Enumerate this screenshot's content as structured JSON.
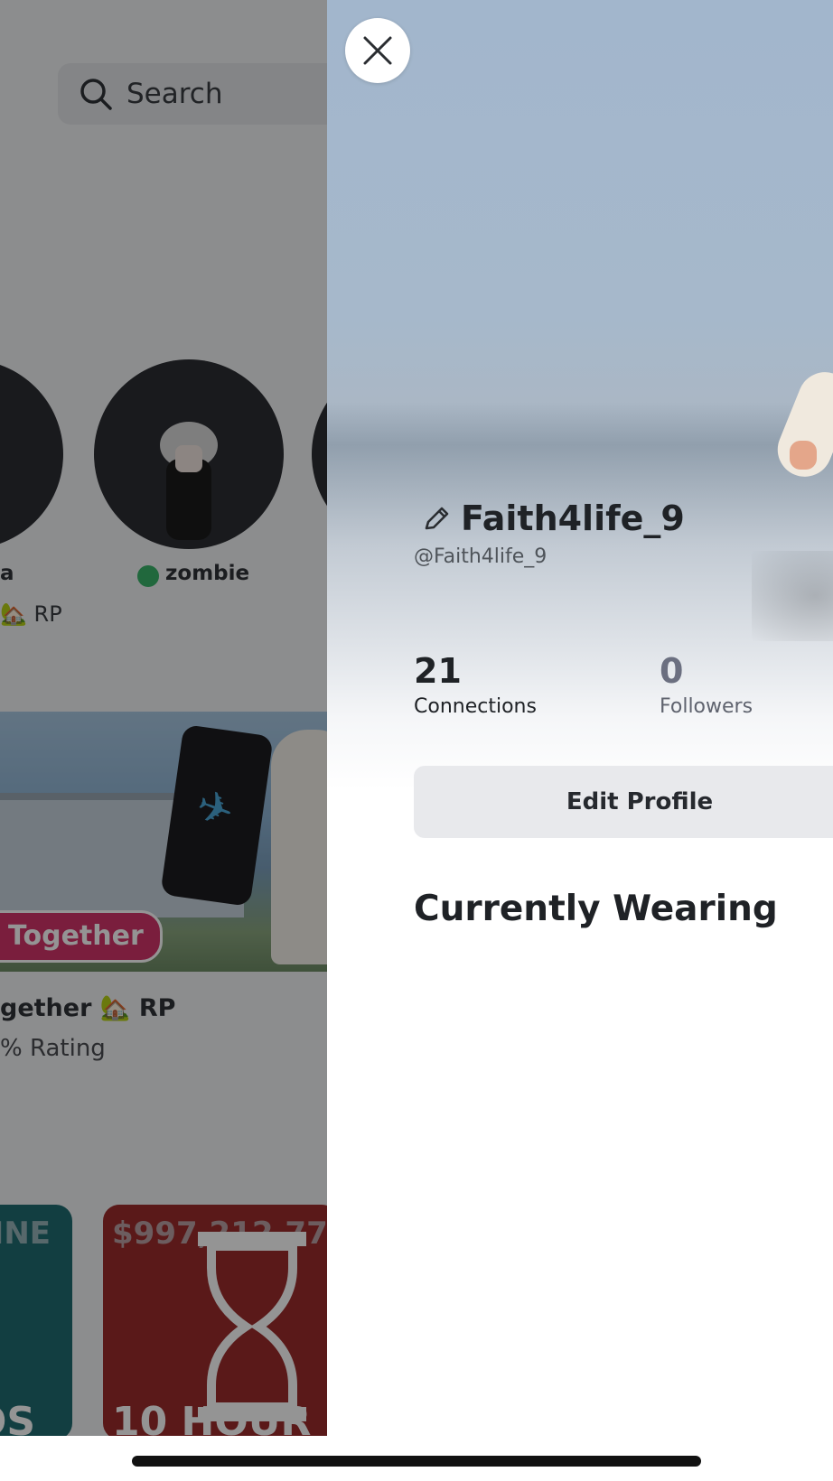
{
  "background": {
    "search": {
      "label": "Search"
    },
    "friends": [
      {
        "name": "a"
      },
      {
        "name": "zombie",
        "online": true
      }
    ],
    "friend_game": "🏡 RP",
    "game": {
      "tag": "Together",
      "title": "gether 🏡 RP",
      "rating": "% Rating"
    },
    "tiles": [
      {
        "top_text": "LINE",
        "bottom_text": "OS"
      },
      {
        "top_text": "$997,212,77",
        "bottom_text": "10 HOUR"
      }
    ]
  },
  "profile": {
    "display_name": "Faith4life_9",
    "username": "@Faith4life_9",
    "stats": [
      {
        "value": "21",
        "label": "Connections"
      },
      {
        "value": "0",
        "label": "Followers"
      }
    ],
    "edit_profile_label": "Edit Profile",
    "section_title": "Currently Wearing"
  },
  "icons": {
    "close": "close-icon",
    "edit": "pencil-icon",
    "search": "search-icon",
    "hourglass": "hourglass-icon"
  },
  "colors": {
    "online": "#39b36a",
    "tag": "#d2346a"
  }
}
